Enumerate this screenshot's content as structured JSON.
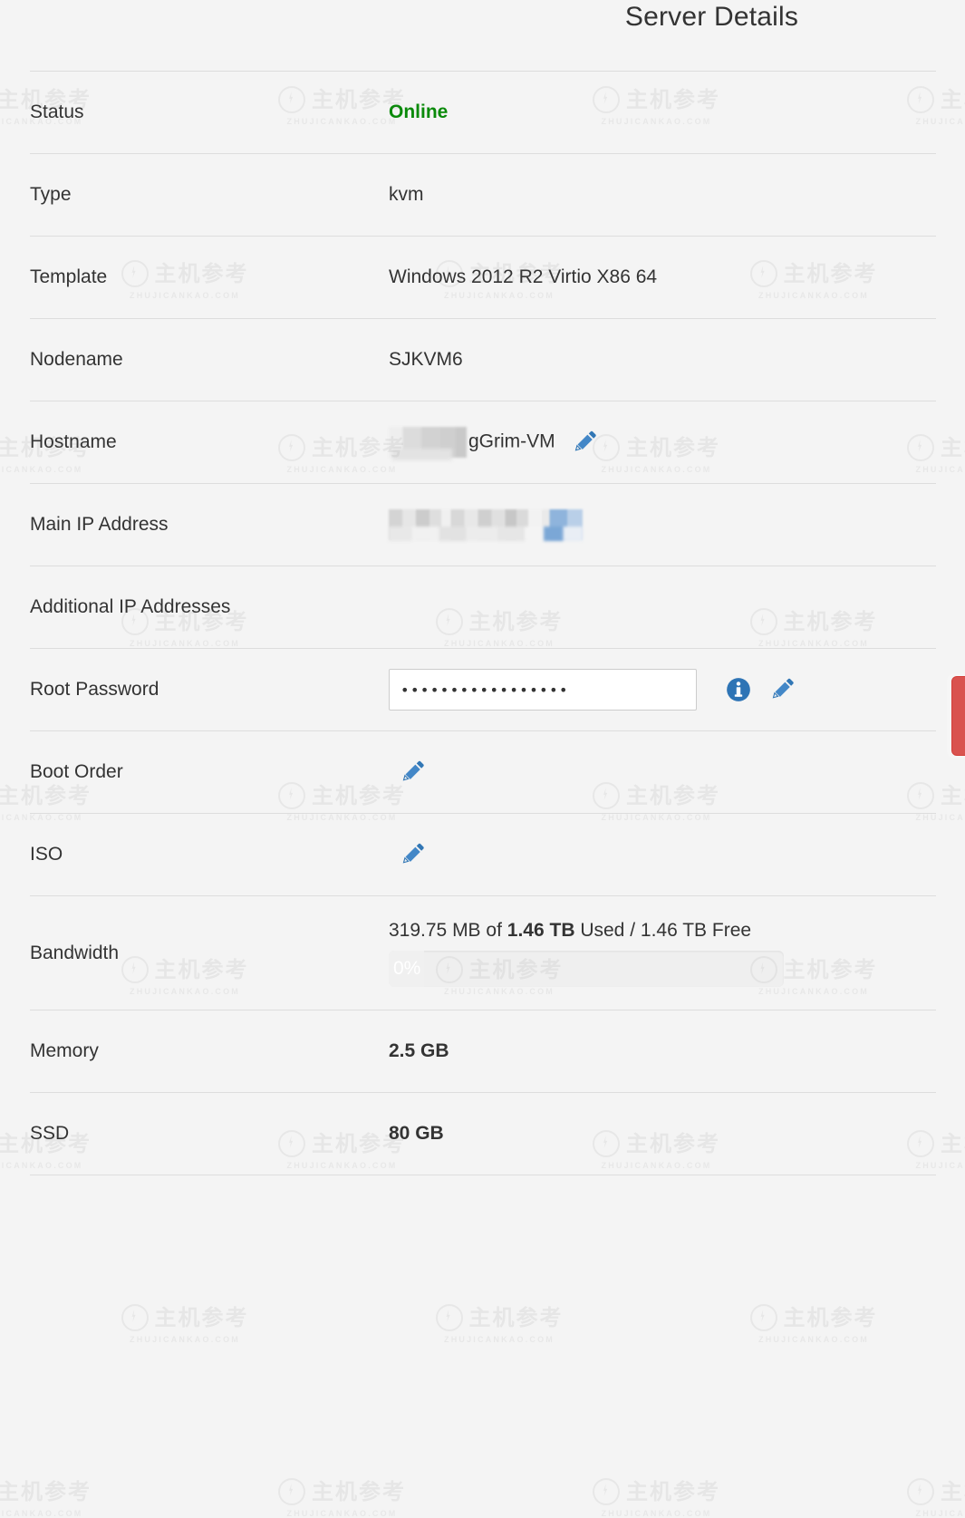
{
  "panel": {
    "title": "Server Details"
  },
  "rows": [
    {
      "label": "Status",
      "value": "Online"
    },
    {
      "label": "Type",
      "value": "kvm"
    },
    {
      "label": "Template",
      "value": "Windows 2012 R2 Virtio X86 64"
    },
    {
      "label": "Nodename",
      "value": "SJKVM6"
    },
    {
      "label": "Hostname",
      "value": "gGrim-VM"
    },
    {
      "label": "Main IP Address",
      "value": ""
    },
    {
      "label": "Additional IP Addresses",
      "value": ""
    },
    {
      "label": "Root Password",
      "value": ""
    },
    {
      "label": "Boot Order",
      "value": ""
    },
    {
      "label": "ISO",
      "value": ""
    },
    {
      "label": "Bandwidth",
      "value": ""
    },
    {
      "label": "Memory",
      "value": "2.5 GB"
    },
    {
      "label": "SSD",
      "value": "80 GB"
    }
  ],
  "status": {
    "value": "Online",
    "color": "#0a8a0a"
  },
  "type": {
    "value": "kvm"
  },
  "template": {
    "value": "Windows 2012 R2 Virtio X86 64"
  },
  "nodename": {
    "value": "SJKVM6"
  },
  "hostname": {
    "visible_value": "gGrim-VM",
    "edit_icon": "pencil-icon"
  },
  "main_ip": {
    "value": ""
  },
  "additional_ips": {
    "value": ""
  },
  "root_password": {
    "masked_value": "•••••••••••••••••",
    "placeholder": "",
    "info_icon": "info-icon",
    "edit_icon": "pencil-icon"
  },
  "boot_order": {
    "edit_icon": "pencil-icon"
  },
  "iso": {
    "edit_icon": "pencil-icon"
  },
  "bandwidth": {
    "used": "319.75 MB",
    "of_label": "of",
    "total": "1.46 TB",
    "used_label": "Used",
    "separator": "/",
    "free": "1.46 TB Free",
    "summary": "319.75 MB of 1.46 TB Used / 1.46 TB Free",
    "percent_label": "0%",
    "percent_value": 0
  },
  "memory": {
    "value": "2.5 GB"
  },
  "ssd": {
    "value": "80 GB"
  },
  "actions": {
    "danger_button_color": "#d9534f"
  },
  "watermark": {
    "text_cn": "主机参考",
    "text_en": "ZHUJICANKAO.COM",
    "logo": "bolt-circle-icon"
  },
  "colors": {
    "background": "#f4f4f4",
    "text": "#333333",
    "divider": "#dddddd",
    "accent_blue": "#3277b5",
    "status_green": "#0a8a0a",
    "danger_red": "#d9534f"
  }
}
